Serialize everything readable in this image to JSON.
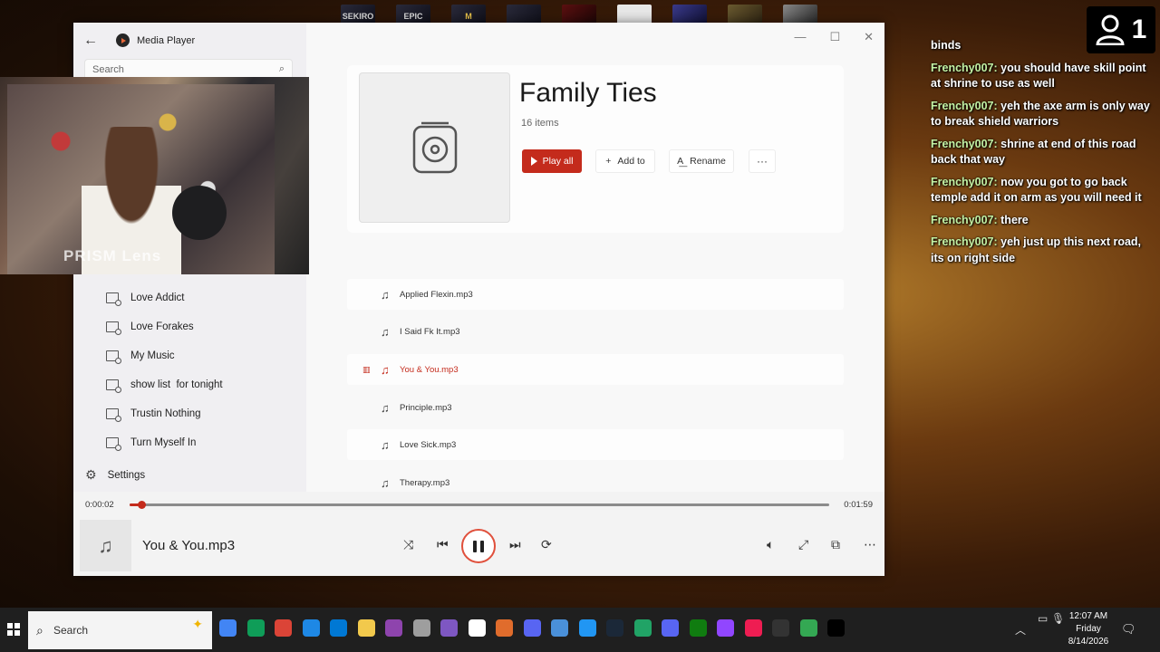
{
  "desktop": {
    "top_icons": [
      "SEKIRO",
      "EPIC",
      "",
      "",
      "",
      "",
      "",
      "",
      ""
    ]
  },
  "viewer_badge": {
    "count": "1"
  },
  "chat": {
    "messages": [
      {
        "user": "",
        "text": "binds"
      },
      {
        "user": "Frenchy007:",
        "text": "you should have skill point at shrine to use as well"
      },
      {
        "user": "Frenchy007:",
        "text": "yeh the axe arm is only way to break shield warriors"
      },
      {
        "user": "Frenchy007:",
        "text": "shrine at end of this road back that way"
      },
      {
        "user": "Frenchy007:",
        "text": "now you got to go back temple add it on arm as you will need it"
      },
      {
        "user": "Frenchy007:",
        "text": "there"
      },
      {
        "user": "Frenchy007:",
        "text": "yeh just up this next road, its on right side"
      }
    ]
  },
  "webcam": {
    "label": "PRISM Lens"
  },
  "player": {
    "app_title": "Media Player",
    "search_placeholder": "Search",
    "sidebar_playlists": [
      "Love Addict",
      "Love Forakes",
      "My Music",
      "show list  for tonight",
      "Trustin Nothing",
      "Turn Myself In"
    ],
    "settings_label": "Settings",
    "playlist": {
      "title": "Family Ties",
      "item_count": "16 items",
      "play_all_label": "Play all",
      "add_to_label": "Add to",
      "rename_label": "Rename",
      "more_label": "···"
    },
    "tracks": [
      {
        "name": "Applied Flexin.mp3",
        "active": false
      },
      {
        "name": "I Said Fk It.mp3",
        "active": false
      },
      {
        "name": "You & You.mp3",
        "active": true
      },
      {
        "name": "Principle.mp3",
        "active": false
      },
      {
        "name": "Love Sick.mp3",
        "active": false
      },
      {
        "name": "Therapy.mp3",
        "active": false
      }
    ],
    "now_playing": {
      "title": "You & You.mp3",
      "current_time": "0:00:02",
      "total_time": "0:01:59",
      "progress_fraction": 0.017
    }
  },
  "taskbar": {
    "search_label": "Search",
    "clock_time": "12:07 AM",
    "clock_day": "Friday",
    "clock_date": "8/14/2026",
    "app_colors": [
      "#4285f4",
      "#0f9d58",
      "#db4437",
      "#1e88e5",
      "#0078d4",
      "#f2c94c",
      "#8e44ad",
      "#9e9e9e",
      "#7e57c2",
      "#ffffff",
      "#e06c2c",
      "#5865f2",
      "#4a90d9",
      "#2196f3",
      "#1b2838",
      "#21a366",
      "#5865f2",
      "#107c10",
      "#9146ff",
      "#ee1d52",
      "#333333",
      "#34a853",
      "#000000"
    ]
  },
  "colors": {
    "accent": "#c42b1c",
    "chat_user": "#c4f2a4"
  }
}
